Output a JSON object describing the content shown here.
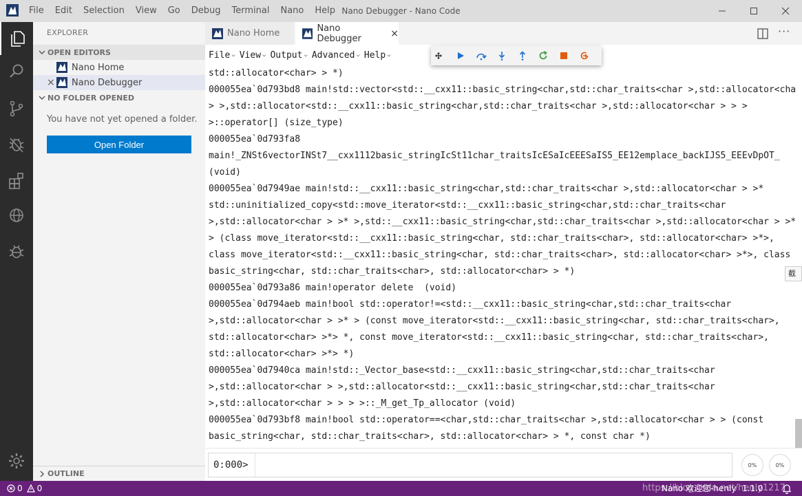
{
  "titlebar": {
    "title": "Nano Debugger - Nano Code",
    "menu": [
      "File",
      "Edit",
      "Selection",
      "View",
      "Go",
      "Debug",
      "Terminal",
      "Nano",
      "Help"
    ]
  },
  "sidebar": {
    "explorer_title": "EXPLORER",
    "open_editors_label": "OPEN EDITORS",
    "open_editors": [
      {
        "label": "Nano Home"
      },
      {
        "label": "Nano Debugger"
      }
    ],
    "no_folder_label": "NO FOLDER OPENED",
    "no_folder_message": "You have not yet opened a folder.",
    "open_folder_button": "Open Folder",
    "outline_label": "OUTLINE"
  },
  "tabs": [
    {
      "label": "Nano Home",
      "active": false
    },
    {
      "label": "Nano Debugger",
      "active": true
    }
  ],
  "app_menu": [
    "File",
    "View",
    "Output",
    "Advanced",
    "Help"
  ],
  "debug_toolbar": [
    "move-icon",
    "continue-icon",
    "step-over-icon",
    "step-into-icon",
    "step-out-icon",
    "restart-icon",
    "stop-icon",
    "disconnect-icon"
  ],
  "output_lines": [
    "std::allocator<char> > *)",
    "000055ea`0d793bd8 main!std::vector<std::__cxx11::basic_string<char,std::char_traits<char >,std::allocator<char",
    "> >,std::allocator<std::__cxx11::basic_string<char,std::char_traits<char >,std::allocator<char > > >",
    ">::operator[] (size_type)",
    "000055ea`0d793fa8",
    "main!_ZNSt6vectorINSt7__cxx1112basic_stringIcSt11char_traitsIcESaIcEEESaIS5_EE12emplace_backIJS5_EEEvDpOT_",
    "(void)",
    "000055ea`0d7949ae main!std::__cxx11::basic_string<char,std::char_traits<char >,std::allocator<char > >*",
    "std::uninitialized_copy<std::move_iterator<std::__cxx11::basic_string<char,std::char_traits<char",
    ">,std::allocator<char > >* >,std::__cxx11::basic_string<char,std::char_traits<char >,std::allocator<char > >*",
    "> (class move_iterator<std::__cxx11::basic_string<char, std::char_traits<char>, std::allocator<char> >*>,",
    "class move_iterator<std::__cxx11::basic_string<char, std::char_traits<char>, std::allocator<char> >*>, class",
    "basic_string<char, std::char_traits<char>, std::allocator<char> > *)",
    "000055ea`0d793a86 main!operator delete  (void)",
    "000055ea`0d794aeb main!bool std::operator!=<std::__cxx11::basic_string<char,std::char_traits<char",
    ">,std::allocator<char > >* > (const move_iterator<std::__cxx11::basic_string<char, std::char_traits<char>,",
    "std::allocator<char> >*> *, const move_iterator<std::__cxx11::basic_string<char, std::char_traits<char>,",
    "std::allocator<char> >*> *)",
    "000055ea`0d7940ca main!std::_Vector_base<std::__cxx11::basic_string<char,std::char_traits<char",
    ">,std::allocator<char > >,std::allocator<std::__cxx11::basic_string<char,std::char_traits<char",
    ">,std::allocator<char > > > >::_M_get_Tp_allocator (void)",
    "000055ea`0d793bf8 main!bool std::operator==<char,std::char_traits<char >,std::allocator<char > > (const",
    "basic_string<char, std::char_traits<char>, std::allocator<char> > *, const char *)"
  ],
  "tooltip_text": "截图",
  "prompt": {
    "label": "0:000>",
    "value": ""
  },
  "gauges": [
    {
      "value": "0%"
    },
    {
      "value": "0%"
    }
  ],
  "statusbar": {
    "errors": "0",
    "warnings": "0",
    "user": "Nano 欢迎您-henly",
    "version": "1.1.0",
    "watermark": "https://blog.csdn.net/henly1217"
  },
  "colors": {
    "status_bar": "#68217a",
    "activity_bar": "#2c2c2c",
    "accent_button": "#007acc",
    "continue": "#1e6fd1",
    "restart": "#3a9a3a",
    "stop": "#e35b0f"
  }
}
